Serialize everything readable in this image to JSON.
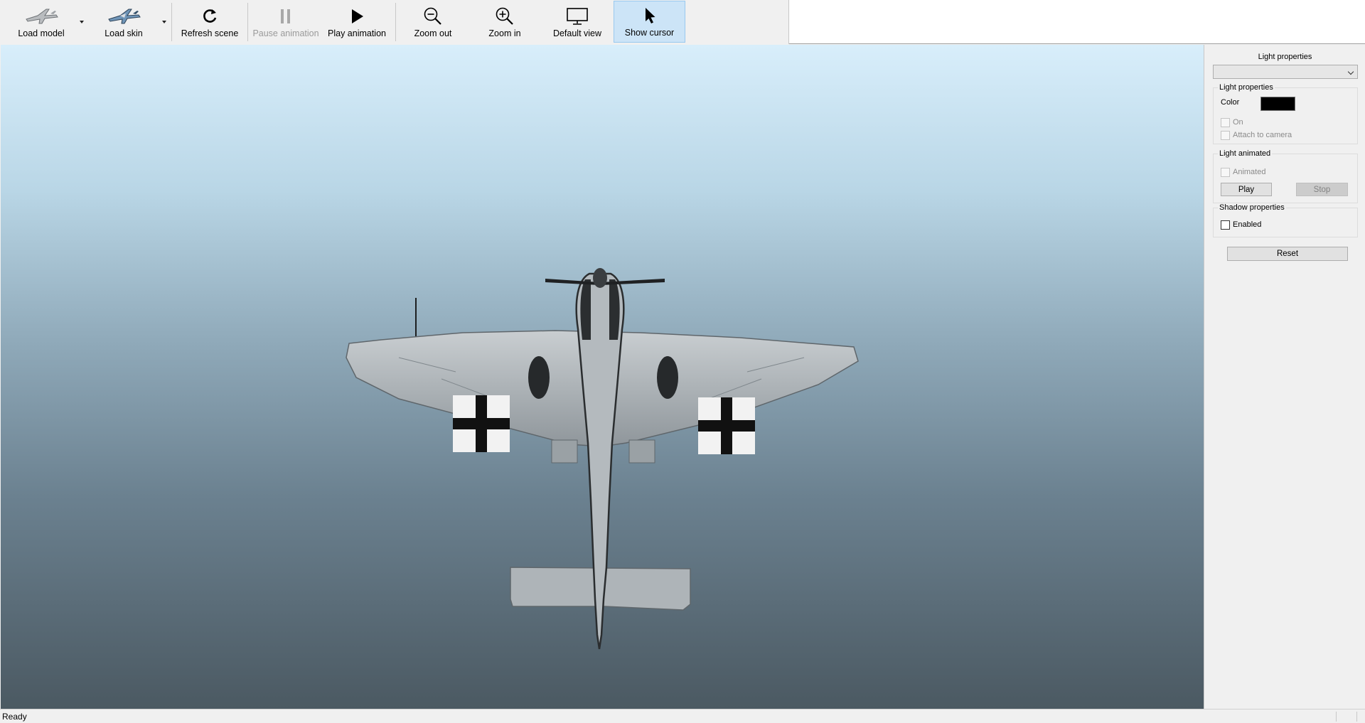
{
  "toolbar": {
    "load_model": "Load model",
    "load_skin": "Load skin",
    "refresh_scene": "Refresh scene",
    "pause_animation": "Pause animation",
    "play_animation": "Play animation",
    "zoom_out": "Zoom out",
    "zoom_in": "Zoom in",
    "default_view": "Default view",
    "show_cursor": "Show cursor"
  },
  "panel": {
    "title": "Light properties",
    "light_selector_value": "",
    "light_group": {
      "label": "Light properties",
      "color_label": "Color",
      "color_value": "#000000",
      "on_label": "On",
      "attach_label": "Attach to camera"
    },
    "animated_group": {
      "label": "Light animated",
      "animated_label": "Animated",
      "play_label": "Play",
      "stop_label": "Stop"
    },
    "shadow_group": {
      "label": "Shadow properties",
      "enabled_label": "Enabled"
    },
    "reset_label": "Reset"
  },
  "status": {
    "text": "Ready"
  },
  "colors": {
    "accent_active": "#cce4f7",
    "sky_top": "#d8eefb",
    "sky_bottom": "#4b5962"
  }
}
